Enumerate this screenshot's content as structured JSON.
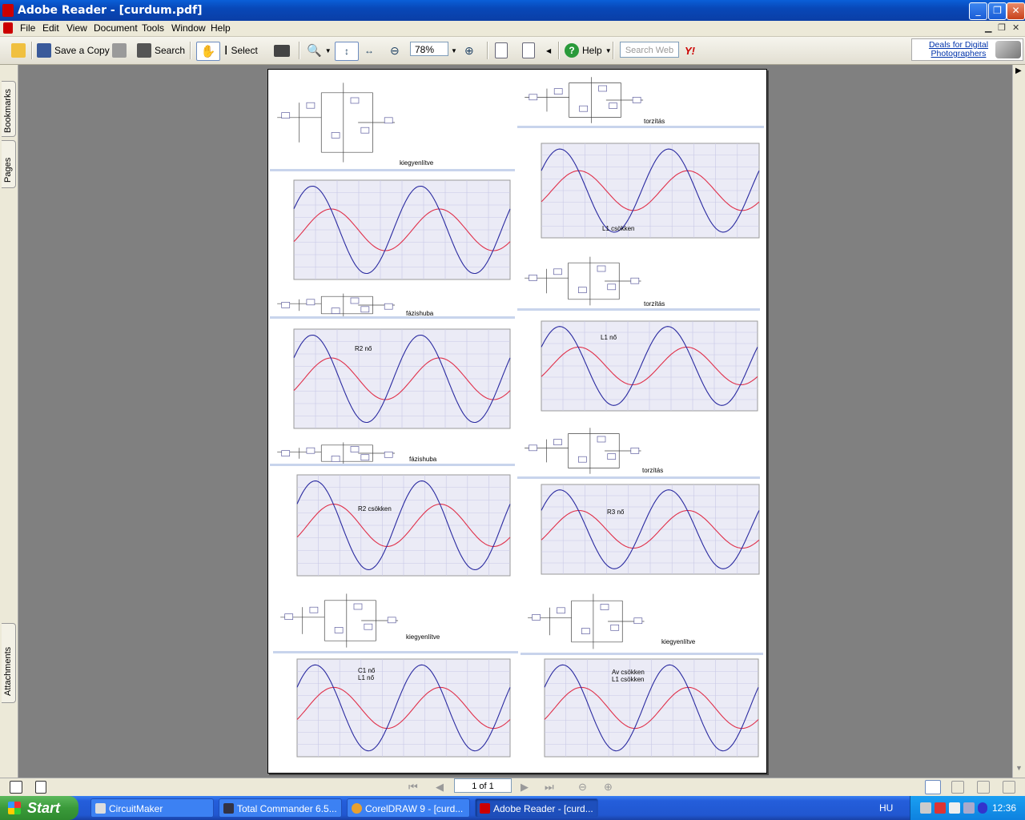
{
  "window": {
    "title": "Adobe Reader - [curdum.pdf]"
  },
  "menu": [
    "File",
    "Edit",
    "View",
    "Document",
    "Tools",
    "Window",
    "Help"
  ],
  "toolbar": {
    "save_copy": "Save a Copy",
    "search": "Search",
    "select": "Select",
    "zoom": "78%",
    "help": "Help",
    "search_placeholder": "Search Web",
    "ad_text": "Deals for Digital Photographers"
  },
  "sidetabs": {
    "bookmarks": "Bookmarks",
    "pages": "Pages",
    "attachments": "Attachments"
  },
  "panels": [
    {
      "id": "p1",
      "kind": "schematic",
      "caption": "kiegyenlítve"
    },
    {
      "id": "p2",
      "kind": "schematic",
      "caption": "torzítás"
    },
    {
      "id": "p3",
      "kind": "chart",
      "caption": "L1 csökken"
    },
    {
      "id": "p4",
      "kind": "chart",
      "caption": ""
    },
    {
      "id": "p5",
      "kind": "schematic",
      "caption": "torzítás"
    },
    {
      "id": "p6",
      "kind": "schematic",
      "caption": "fázishuba"
    },
    {
      "id": "p7",
      "kind": "chart",
      "caption": "R2 nő"
    },
    {
      "id": "p8",
      "kind": "chart",
      "caption": "L1 nő"
    },
    {
      "id": "p9",
      "kind": "schematic",
      "caption": "fázishuba"
    },
    {
      "id": "p10",
      "kind": "schematic",
      "caption": "torzítás"
    },
    {
      "id": "p11",
      "kind": "chart",
      "caption": "R2 csökken"
    },
    {
      "id": "p12",
      "kind": "chart",
      "caption": "R3 nő"
    },
    {
      "id": "p13",
      "kind": "schematic",
      "caption": "kiegyenlítve"
    },
    {
      "id": "p14",
      "kind": "schematic",
      "caption": "kiegyenlítve"
    },
    {
      "id": "p15",
      "kind": "chart",
      "caption": "C1 nő\nL1 nő"
    },
    {
      "id": "p16",
      "kind": "chart",
      "caption": "Av csökken\nL1 csökken"
    }
  ],
  "colors": {
    "blue_trace": "#2a2aa0",
    "red_trace": "#e0304a",
    "grid": "#c8c8e6",
    "plotbg": "#ebebf6"
  },
  "statusbar": {
    "page_indicator": "1 of 1"
  },
  "taskbar": {
    "start": "Start",
    "tasks": [
      "CircuitMaker",
      "Total Commander 6.5...",
      "CorelDRAW 9 - [curd...",
      "Adobe Reader - [curd..."
    ],
    "lang": "HU",
    "clock": "12:36"
  }
}
